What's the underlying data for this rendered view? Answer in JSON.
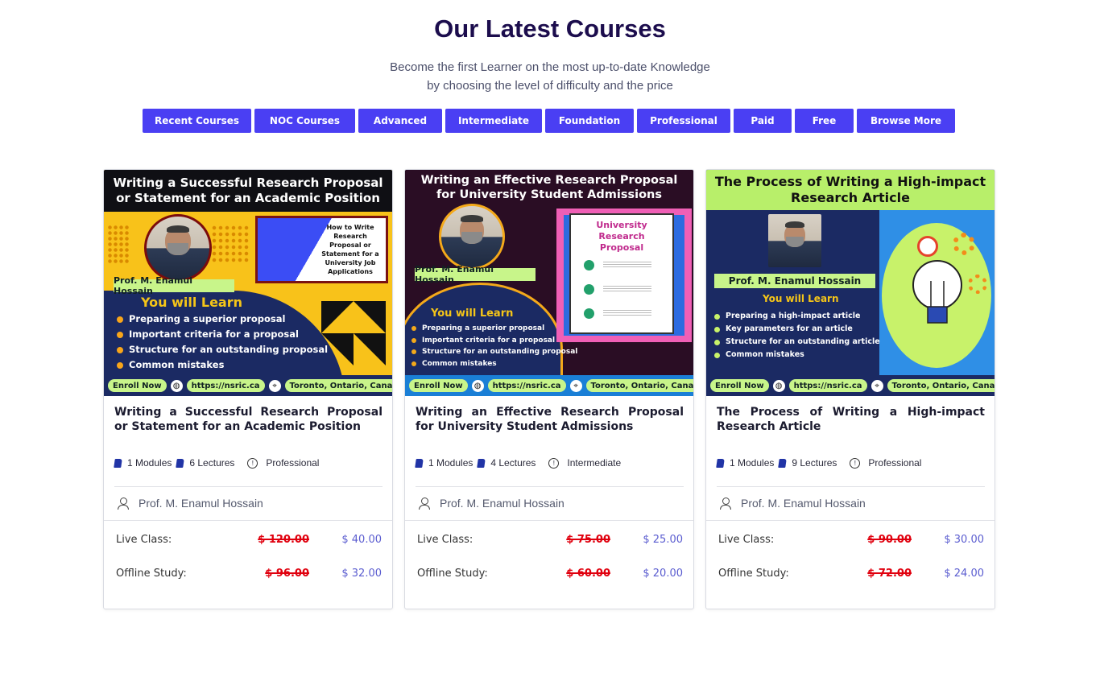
{
  "header": {
    "title": "Our Latest Courses",
    "subtitle_line1": "Become the first Learner on the most up-to-date Knowledge",
    "subtitle_line2": "by choosing the level of difficulty and the price"
  },
  "filters": [
    "Recent Courses",
    "NOC Courses",
    "Advanced",
    "Intermediate",
    "Foundation",
    "Professional",
    "Paid",
    "Free",
    "Browse More"
  ],
  "labels": {
    "modules_suffix": "Modules",
    "lectures_suffix": "Lectures",
    "live_class": "Live Class:",
    "offline_study": "Offline Study:"
  },
  "courses": [
    {
      "thumb": {
        "title": "Writing a Successful Research Proposal or Statement for an Academic Position",
        "instructor": "Prof. M. Enamul Hossain",
        "learn_heading": "You will Learn",
        "points": [
          "Preparing a superior proposal",
          "Important criteria for a proposal",
          "Structure for an outstanding proposal",
          "Common mistakes"
        ],
        "side_card": "How to Write Research Proposal or Statement for a University Job Applications",
        "enroll": "Enroll Now",
        "site": "https://nsric.ca",
        "location": "Toronto, Ontario, Canada"
      },
      "title": "Writing a Successful Research Proposal or Statement for an Academic Position",
      "modules": "1 Modules",
      "lectures": "6 Lectures",
      "level": "Professional",
      "instructor": "Prof. M. Enamul Hossain",
      "live_old": "$ 120.00",
      "live_new": "$ 40.00",
      "offline_old": "$ 96.00",
      "offline_new": "$ 32.00"
    },
    {
      "thumb": {
        "title": "Writing an Effective Research Proposal for University Student Admissions",
        "instructor": "Prof. M. Enamul Hossain",
        "learn_heading": "You will Learn",
        "points": [
          "Preparing a superior proposal",
          "Important criteria for a proposal",
          "Structure for an outstanding proposal",
          "Common mistakes"
        ],
        "side_card": "University Research Proposal",
        "enroll": "Enroll Now",
        "site": "https://nsric.ca",
        "location": "Toronto, Ontario, Canada"
      },
      "title": "Writing an Effective Research Proposal for University Student Admissions",
      "modules": "1 Modules",
      "lectures": "4 Lectures",
      "level": "Intermediate",
      "instructor": "Prof. M. Enamul Hossain",
      "live_old": "$ 75.00",
      "live_new": "$ 25.00",
      "offline_old": "$ 60.00",
      "offline_new": "$ 20.00"
    },
    {
      "thumb": {
        "title": "The Process of Writing a High-impact Research Article",
        "instructor": "Prof. M. Enamul Hossain",
        "learn_heading": "You will Learn",
        "points": [
          "Preparing a high-impact article",
          "Key parameters for an article",
          "Structure for an outstanding article",
          "Common mistakes"
        ],
        "enroll": "Enroll Now",
        "site": "https://nsric.ca",
        "location": "Toronto, Ontario, Canada"
      },
      "title": "The Process of Writing a High-impact Research Article",
      "modules": "1 Modules",
      "lectures": "9 Lectures",
      "level": "Professional",
      "instructor": "Prof. M. Enamul Hossain",
      "live_old": "$ 90.00",
      "live_new": "$ 30.00",
      "offline_old": "$ 72.00",
      "offline_new": "$ 24.00"
    }
  ]
}
